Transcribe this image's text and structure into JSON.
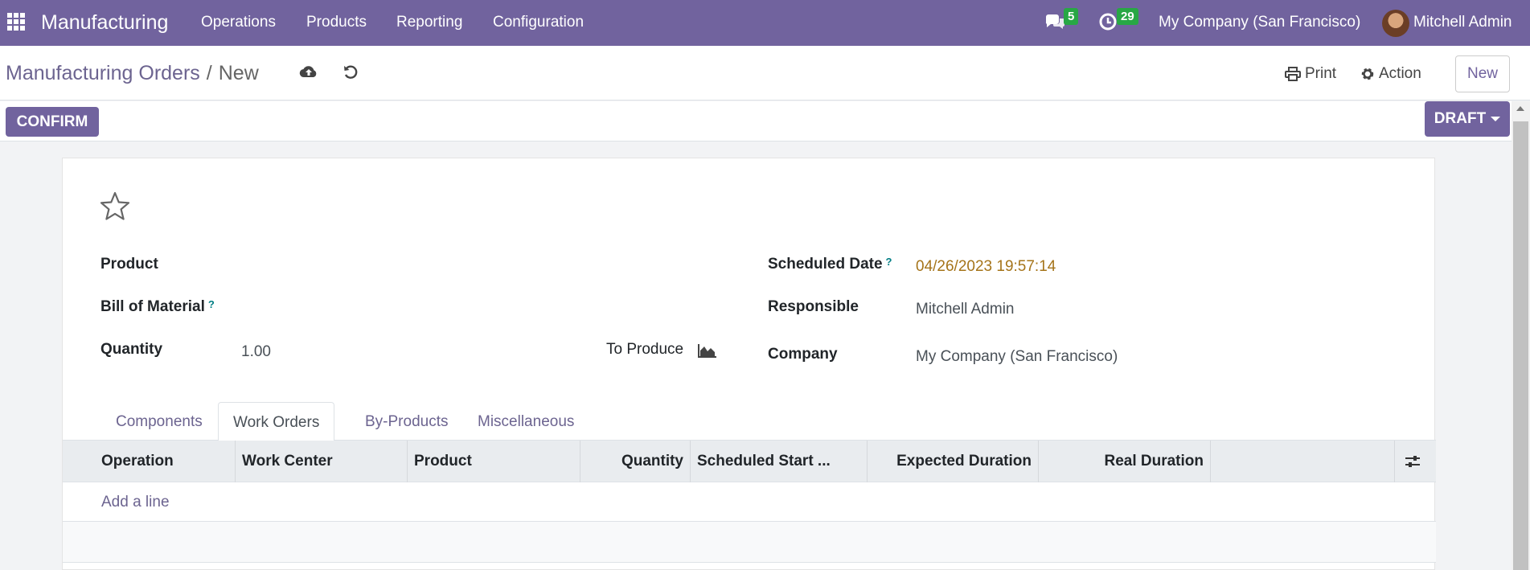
{
  "navbar": {
    "brand": "Manufacturing",
    "menus": [
      "Operations",
      "Products",
      "Reporting",
      "Configuration"
    ],
    "messages_count": "5",
    "activities_count": "29",
    "company": "My Company (San Francisco)",
    "user": "Mitchell Admin"
  },
  "control": {
    "breadcrumb_parent": "Manufacturing Orders",
    "breadcrumb_sep": "/",
    "breadcrumb_current": "New",
    "print_label": "Print",
    "action_label": "Action",
    "new_label": "New"
  },
  "status": {
    "confirm_label": "CONFIRM",
    "draft_label": "DRAFT"
  },
  "form": {
    "product_label": "Product",
    "bom_label": "Bill of Material",
    "quantity_label": "Quantity",
    "quantity_value": "1.00",
    "to_produce_label": "To Produce",
    "scheduled_date_label": "Scheduled Date",
    "scheduled_date_value": "04/26/2023 19:57:14",
    "responsible_label": "Responsible",
    "responsible_value": "Mitchell Admin",
    "company_label": "Company",
    "company_value": "My Company (San Francisco)",
    "help_mark": "?"
  },
  "tabs": [
    "Components",
    "Work Orders",
    "By-Products",
    "Miscellaneous"
  ],
  "table": {
    "columns": [
      "Operation",
      "Work Center",
      "Product",
      "Quantity",
      "Scheduled Start ...",
      "Expected Duration",
      "Real Duration"
    ],
    "add_line": "Add a line"
  },
  "colors": {
    "primary": "#71639e",
    "badge": "#28a745",
    "date": "#a5741a"
  }
}
